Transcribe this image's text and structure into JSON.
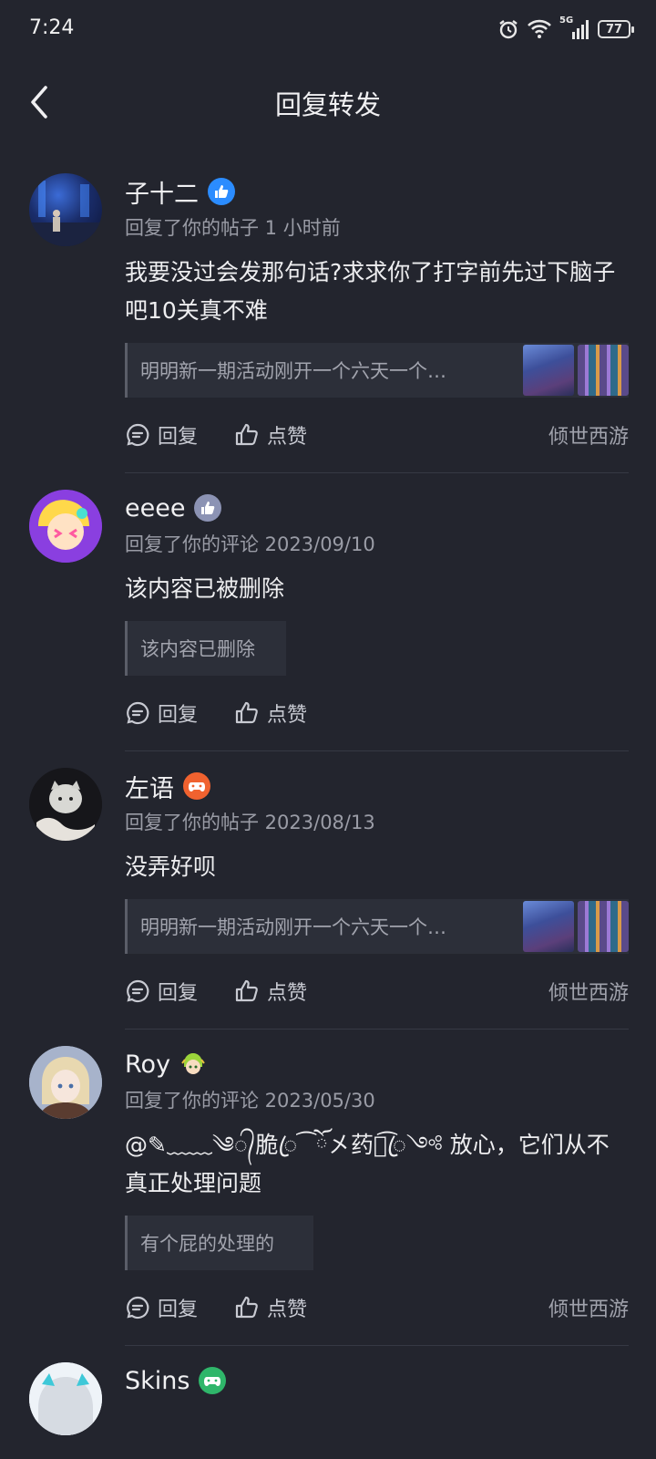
{
  "status_bar": {
    "time": "7:24",
    "battery": "77",
    "network": "5G"
  },
  "header": {
    "title": "回复转发"
  },
  "actions": {
    "reply": "回复",
    "like": "点赞"
  },
  "items": [
    {
      "name": "子十二",
      "badge_icon": "thumbs-up-badge-icon",
      "badge_color": "#2b8cff",
      "meta": "回复了你的帖子 1 小时前",
      "content": "我要没过会发那句话?求求你了打字前先过下脑子吧10关真不难",
      "quote": "明明新一期活动刚开一个六天一个…",
      "has_thumbs": true,
      "source": "倾世西游"
    },
    {
      "name": "eeee",
      "badge_icon": "thumbs-up-badge-icon",
      "badge_color": "#8c93b4",
      "meta": "回复了你的评论 2023/09/10",
      "content": "该内容已被删除",
      "quote": "该内容已删除",
      "has_thumbs": false,
      "source": ""
    },
    {
      "name": "左语",
      "badge_icon": "gamepad-badge-icon",
      "badge_color": "#f0622f",
      "meta": "回复了你的帖子 2023/08/13",
      "content": "没弄好呗",
      "quote": "明明新一期活动刚开一个六天一个…",
      "has_thumbs": true,
      "source": "倾世西游"
    },
    {
      "name": "Roy",
      "badge_icon": "character-badge-icon",
      "badge_color": "#9bd43a",
      "meta": "回复了你的评论 2023/05/30",
      "content": "@✎﹏﹏༄᭄脆ꦿ⁀ོ㐅药ོ͡ꦿ༺ 放心，它们从不真正处理问题",
      "quote": "有个屁的处理的",
      "has_thumbs": false,
      "source": "倾世西游"
    },
    {
      "name": "Skins",
      "badge_icon": "gamepad-badge-icon",
      "badge_color": "#2fb66a"
    }
  ]
}
